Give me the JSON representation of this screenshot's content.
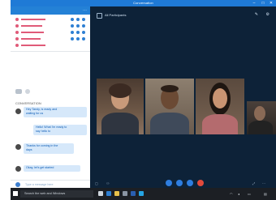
{
  "window": {
    "title": "Conversation",
    "controls": {
      "minimize": "–",
      "maximize": "□",
      "close": "✕"
    }
  },
  "sidebar": {
    "header_label": "",
    "participants": [
      {
        "status_color": "#e05a78"
      },
      {
        "status_color": "#e05a78"
      },
      {
        "status_color": "#e05a78"
      },
      {
        "status_color": "#e05a78"
      },
      {
        "status_color": "#e05a78"
      }
    ],
    "conversation_header": "CONVERSATION",
    "messages": [
      {
        "line1": "Hey Tandy, is ready and",
        "line2": "waiting for us"
      },
      {
        "line1": "Hello! What I'm ready to",
        "line2": "say hello to"
      },
      {
        "line1": "Thanks for coming in the",
        "line2": "days"
      },
      {
        "line1": "Okay, let's get started"
      }
    ],
    "compose_placeholder": "Type a message here"
  },
  "call": {
    "title": "All Participants",
    "icons": [
      "pen-icon",
      "settings-icon"
    ]
  },
  "controls": {
    "buttons": [
      "camera-button",
      "mic-button",
      "share-button",
      "end-call-button"
    ]
  },
  "taskbar": {
    "search_placeholder": "Search the web and Windows",
    "apps": [
      "edge-icon",
      "explorer-icon",
      "store-icon",
      "word-icon",
      "skype-icon"
    ]
  },
  "colors": {
    "accent": "#1f7ad6",
    "video_bg": "#0d2238",
    "end_call": "#e24a3b",
    "control_blue": "#2e7ee0"
  }
}
